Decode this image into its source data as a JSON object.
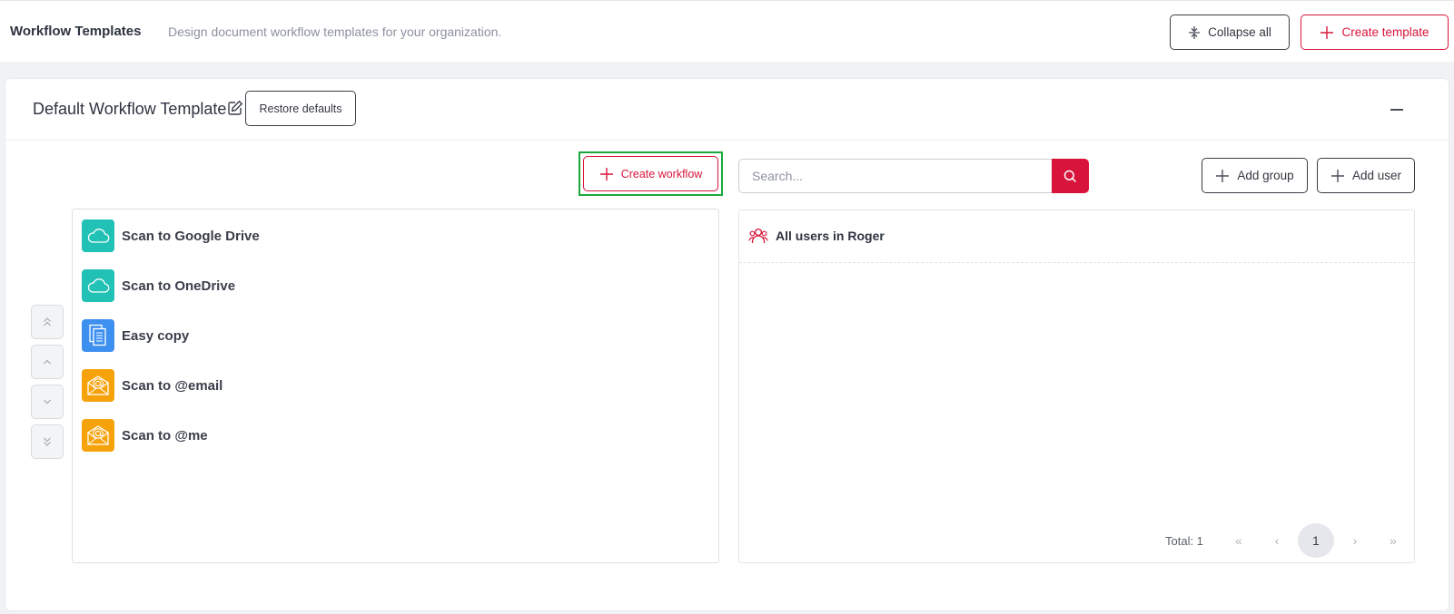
{
  "header": {
    "title": "Workflow Templates",
    "subtitle": "Design document workflow templates for your organization.",
    "collapse_all_label": "Collapse all",
    "create_template_label": "Create template"
  },
  "template": {
    "name": "Default Workflow Template",
    "restore_label": "Restore defaults"
  },
  "toolbar": {
    "create_workflow_label": "Create workflow",
    "search_placeholder": "Search...",
    "add_group_label": "Add group",
    "add_user_label": "Add user"
  },
  "workflows": [
    {
      "label": "Scan to Google Drive",
      "icon": "cloud-icon",
      "color": "#22c1b5"
    },
    {
      "label": "Scan to OneDrive",
      "icon": "cloud-icon",
      "color": "#22c1b5"
    },
    {
      "label": "Easy copy",
      "icon": "document-copy-icon",
      "color": "#3d8ff0"
    },
    {
      "label": "Scan to @email",
      "icon": "email-at-icon",
      "color": "#f5a20b"
    },
    {
      "label": "Scan to @me",
      "icon": "email-at-icon",
      "color": "#f5a20b"
    }
  ],
  "users": {
    "group_label": "All users in Roger",
    "total_label": "Total: 1",
    "current_page": "1",
    "first_glyph": "«",
    "prev_glyph": "‹",
    "next_glyph": "›",
    "last_glyph": "»"
  },
  "colors": {
    "accent": "#d9143a",
    "highlight": "#1aa83a"
  }
}
